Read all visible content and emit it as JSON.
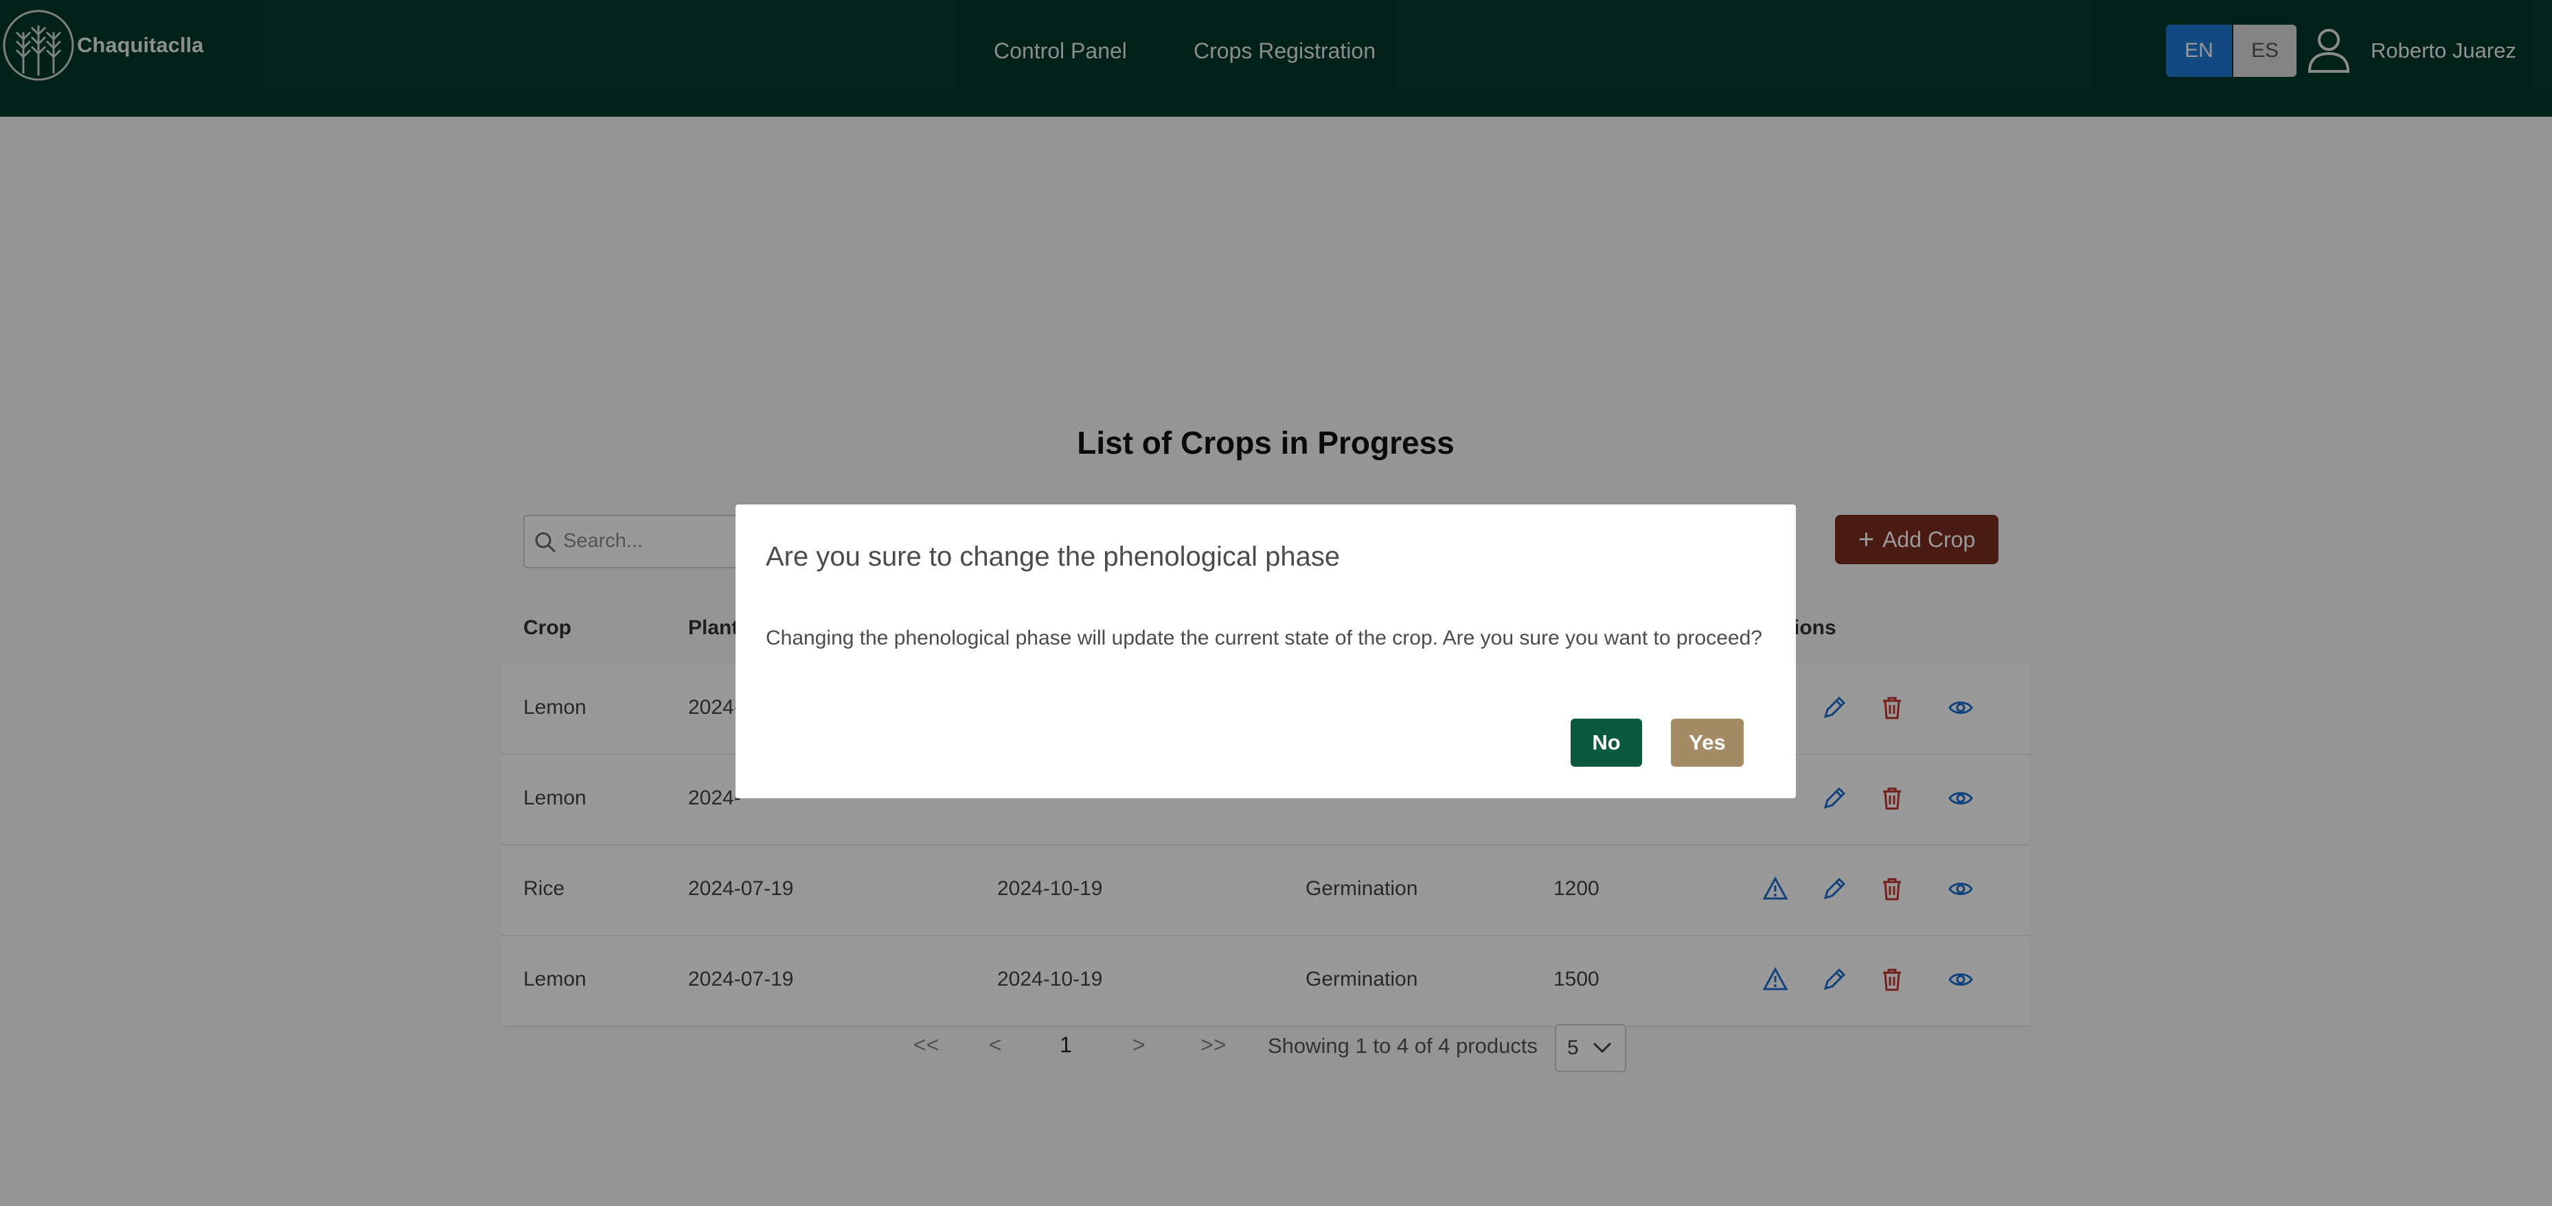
{
  "header": {
    "brand": "Chaquitaclla",
    "nav": [
      "Control Panel",
      "Crops Registration"
    ],
    "languages": [
      "EN",
      "ES"
    ],
    "active_language": "EN",
    "user_name": "Roberto Juarez"
  },
  "page": {
    "title": "List of Crops in Progress"
  },
  "toolbar": {
    "search_placeholder": "Search...",
    "add_button": "Add Crop"
  },
  "table": {
    "columns": [
      "Crop",
      "Plant",
      "",
      "",
      "",
      "ions"
    ],
    "rows": [
      {
        "crop": "Lemon",
        "planting": "2024-",
        "harvest": "",
        "phase": "",
        "area": ""
      },
      {
        "crop": "Lemon",
        "planting": "2024-",
        "harvest": "",
        "phase": "",
        "area": ""
      },
      {
        "crop": "Rice",
        "planting": "2024-07-19",
        "harvest": "2024-10-19",
        "phase": "Germination",
        "area": "1200"
      },
      {
        "crop": "Lemon",
        "planting": "2024-07-19",
        "harvest": "2024-10-19",
        "phase": "Germination",
        "area": "1500"
      }
    ]
  },
  "pagination": {
    "first": "<<",
    "prev": "<",
    "current": "1",
    "next": ">",
    "last": ">>",
    "info": "Showing 1 to 4 of 4 products",
    "page_size": "5"
  },
  "modal": {
    "title": "Are you sure to change the phenological phase",
    "message": "Changing the phenological phase will update the current state of the crop. Are you sure you want to proceed?",
    "no_label": "No",
    "yes_label": "Yes"
  },
  "colors": {
    "navbar": "#03382b",
    "add_button": "#7a2e21",
    "no_button": "#0b5a3f",
    "yes_button": "#a58a66",
    "icon_blue": "#1f6fd1",
    "icon_red": "#c0322b"
  }
}
